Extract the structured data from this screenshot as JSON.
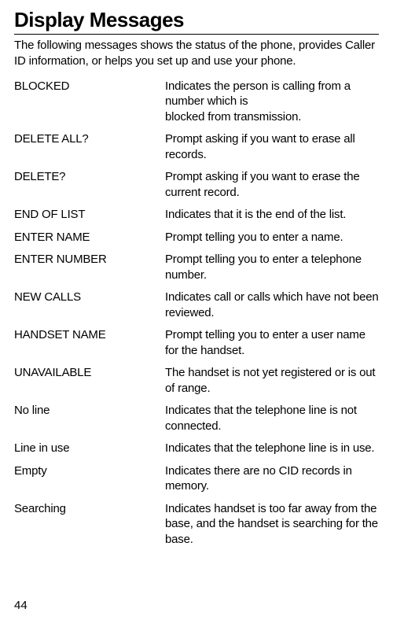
{
  "title": "Display Messages",
  "intro": "The following messages shows the status of the phone, provides Caller ID information, or helps you set up and use your phone.",
  "messages": [
    {
      "term": "BLOCKED",
      "desc": "Indicates the person is calling from a number which is\nblocked from transmission."
    },
    {
      "term": "DELETE ALL?",
      "desc": "Prompt asking if you want to erase all records."
    },
    {
      "term": "DELETE?",
      "desc": "Prompt asking if you want to erase the current record."
    },
    {
      "term": "END OF LIST",
      "desc": "Indicates that it is the end of the list."
    },
    {
      "term": "ENTER NAME",
      "desc": "Prompt telling you to enter a name."
    },
    {
      "term": "ENTER NUMBER",
      "desc": "Prompt telling you to enter a telephone number."
    },
    {
      "term": "NEW CALLS",
      "desc": "Indicates call or calls which have not been reviewed."
    },
    {
      "term": "HANDSET NAME",
      "desc": "Prompt telling you to enter a user name for the handset."
    },
    {
      "term": "UNAVAILABLE",
      "desc": "The handset is not yet registered or is out of range."
    },
    {
      "term": "No line",
      "desc": "Indicates that the telephone line is not connected."
    },
    {
      "term": "Line in use",
      "desc": "Indicates that the telephone line is in use."
    },
    {
      "term": "Empty",
      "desc": "Indicates there are no CID records in memory."
    },
    {
      "term": "Searching",
      "desc": "Indicates handset is too far away from the base, and the handset is searching for the base."
    }
  ],
  "pageNumber": "44"
}
